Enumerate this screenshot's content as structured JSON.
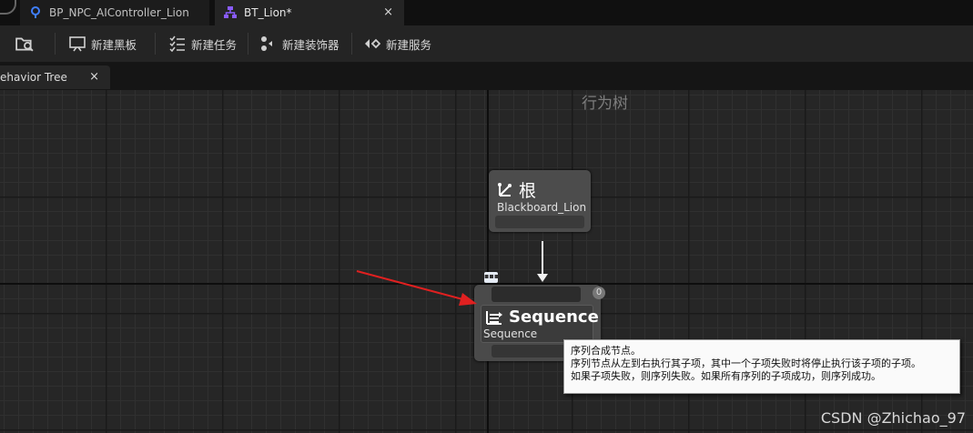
{
  "tabs": [
    {
      "label": "BP_NPC_AIController_Lion"
    },
    {
      "label": "BT_Lion*",
      "close": "×"
    }
  ],
  "toolbar": {
    "new_blackboard": "新建黑板",
    "new_task": "新建任务",
    "new_decorator": "新建装饰器",
    "new_service": "新建服务"
  },
  "panel_tab": {
    "label": "ehavior Tree",
    "close": "×"
  },
  "graph": {
    "title": "行为树",
    "root_node": {
      "title": "根",
      "subtitle": "Blackboard_Lion"
    },
    "sequence_node": {
      "title": "Sequence",
      "subtitle": "Sequence",
      "badge": "0"
    },
    "tooltip": {
      "line1": "序列合成节点。",
      "line2": "序列节点从左到右执行其子项，其中一个子项失败时将停止执行该子项的子项。",
      "line3": "如果子项失败，则序列失败。如果所有序列的子项成功，则序列成功。"
    }
  },
  "watermark": "CSDN @Zhichao_97",
  "colors": {
    "accent_arrow": "#e02020",
    "bt_icon": "#8a5cff",
    "ai_icon": "#3f7fff"
  }
}
